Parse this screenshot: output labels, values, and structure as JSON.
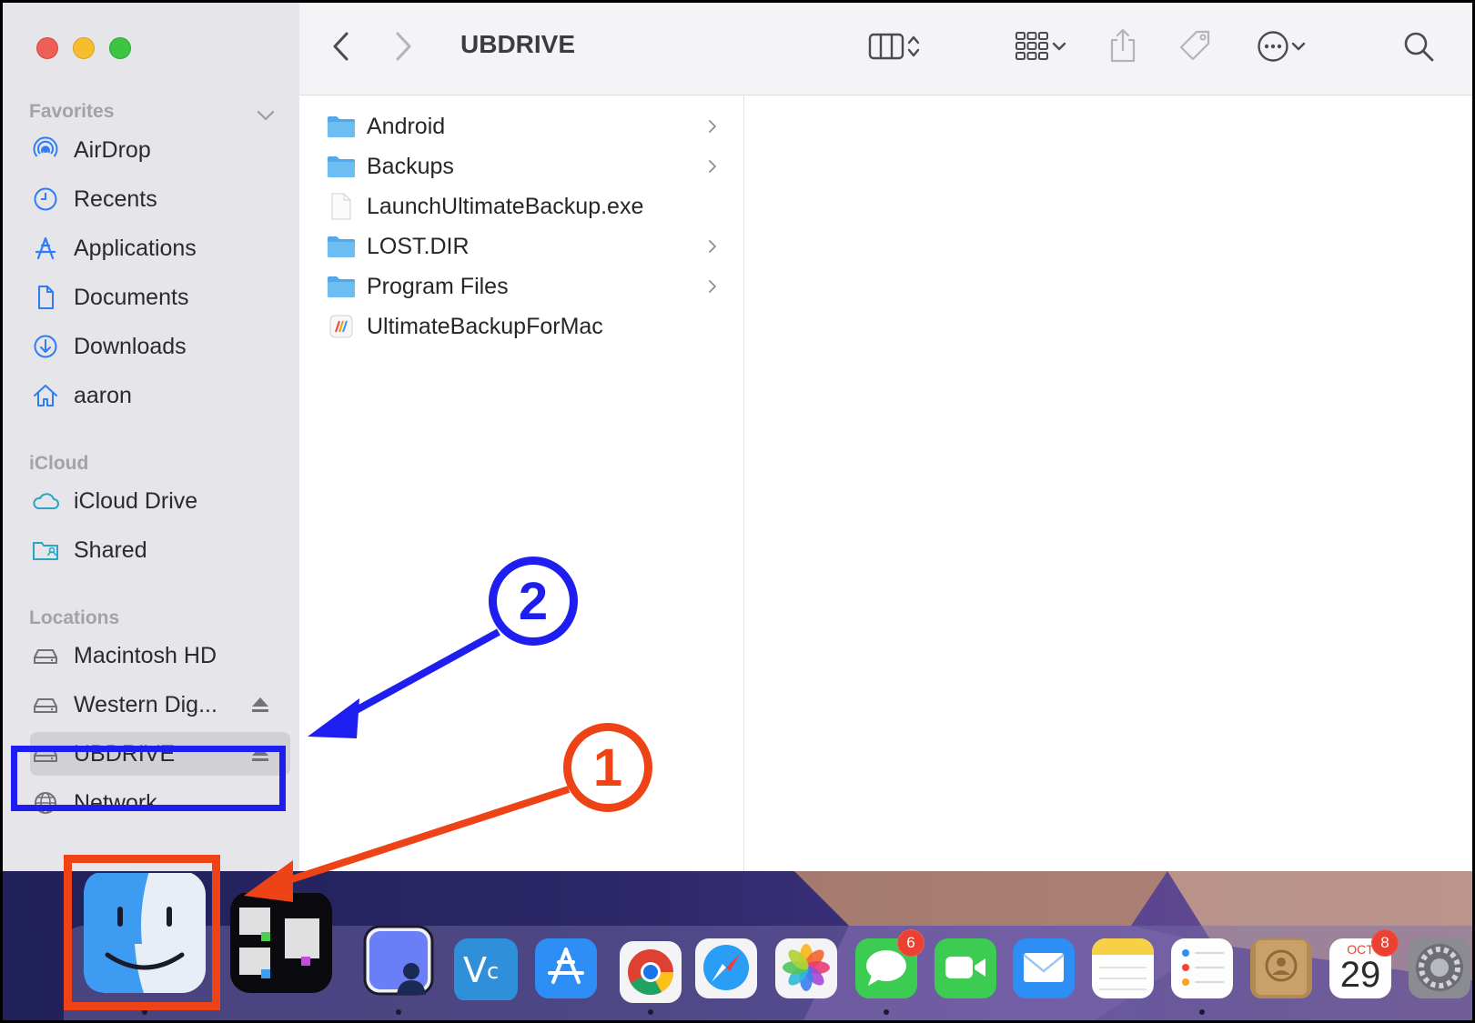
{
  "window": {
    "title": "UBDRIVE"
  },
  "sidebar": {
    "favorites_title": "Favorites",
    "favorites": [
      {
        "label": "AirDrop",
        "icon": "airdrop-icon"
      },
      {
        "label": "Recents",
        "icon": "clock-icon"
      },
      {
        "label": "Applications",
        "icon": "applications-icon"
      },
      {
        "label": "Documents",
        "icon": "document-icon"
      },
      {
        "label": "Downloads",
        "icon": "download-icon"
      },
      {
        "label": "aaron",
        "icon": "home-icon"
      }
    ],
    "icloud_title": "iCloud",
    "icloud": [
      {
        "label": "iCloud Drive",
        "icon": "cloud-icon"
      },
      {
        "label": "Shared",
        "icon": "shared-folder-icon"
      }
    ],
    "locations_title": "Locations",
    "locations": [
      {
        "label": "Macintosh HD",
        "icon": "drive-icon"
      },
      {
        "label": "Western Dig...",
        "icon": "drive-icon",
        "ejectable": true
      },
      {
        "label": "UBDRIVE",
        "icon": "drive-icon",
        "ejectable": true,
        "selected": true
      },
      {
        "label": "Network",
        "icon": "globe-icon"
      }
    ]
  },
  "files": [
    {
      "name": "Android",
      "type": "folder"
    },
    {
      "name": "Backups",
      "type": "folder"
    },
    {
      "name": "LaunchUltimateBackup.exe",
      "type": "file"
    },
    {
      "name": "LOST.DIR",
      "type": "folder"
    },
    {
      "name": "Program Files",
      "type": "folder"
    },
    {
      "name": "UltimateBackupForMac",
      "type": "app"
    }
  ],
  "dock": {
    "apps": [
      {
        "name": "Finder",
        "icon": "finder-icon"
      },
      {
        "name": "Ultimate Backup",
        "icon": "ultimate-backup-icon"
      },
      {
        "name": "Screen Sharing",
        "icon": "screen-sharing-icon"
      },
      {
        "name": "VNC Viewer",
        "icon": "vnc-icon",
        "label": "V"
      },
      {
        "name": "App Store",
        "icon": "app-store-icon"
      },
      {
        "name": "Chrome",
        "icon": "chrome-icon"
      },
      {
        "name": "Safari",
        "icon": "safari-icon"
      },
      {
        "name": "Photos",
        "icon": "photos-icon"
      },
      {
        "name": "Messages",
        "icon": "messages-icon",
        "badge": "6"
      },
      {
        "name": "FaceTime",
        "icon": "facetime-icon"
      },
      {
        "name": "Mail",
        "icon": "mail-icon"
      },
      {
        "name": "Notes",
        "icon": "notes-icon"
      },
      {
        "name": "Reminders",
        "icon": "reminders-icon"
      },
      {
        "name": "Contacts",
        "icon": "contacts-icon"
      },
      {
        "name": "Calendar",
        "icon": "calendar-icon",
        "month": "OCT",
        "day": "29",
        "badge": "8"
      },
      {
        "name": "System Preferences",
        "icon": "gear-icon"
      }
    ]
  },
  "annotations": {
    "step1": "1",
    "step2": "2"
  },
  "colors": {
    "annotation_blue": "#1e1ef0",
    "annotation_red": "#ee4317",
    "folder_blue": "#66b7f2",
    "sidebar_bg": "#e6e5e9"
  }
}
